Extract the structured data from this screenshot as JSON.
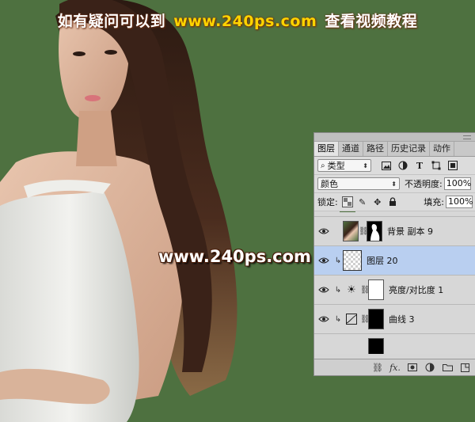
{
  "banner": {
    "part1": "如有疑问可以到",
    "url": "www.240ps.com",
    "part2": "查看视频教程"
  },
  "watermark": "www.240ps.com",
  "panel": {
    "tabs": [
      "图层",
      "通道",
      "路径",
      "历史记录",
      "动作"
    ],
    "active_tab": "图层",
    "filter": {
      "icon": "search-icon",
      "label": "类型"
    },
    "filter_icons": [
      "image-filter-icon",
      "adjustment-filter-icon",
      "type-filter-icon",
      "shape-filter-icon",
      "smart-object-filter-icon"
    ],
    "blend_mode": "颜色",
    "opacity_label": "不透明度:",
    "opacity_value": "100%",
    "lock_label": "锁定:",
    "lock_icons": [
      "lock-transparent-icon",
      "lock-paint-icon",
      "lock-position-icon",
      "lock-all-icon"
    ],
    "fill_label": "填充:",
    "fill_value": "100%",
    "layers": [
      {
        "name": "背景 副本 9",
        "selected": false,
        "clipped": false,
        "type": "pixel-with-mask"
      },
      {
        "name": "图层 20",
        "selected": true,
        "clipped": true,
        "type": "transparent"
      },
      {
        "name": "亮度/对比度 1",
        "selected": false,
        "clipped": true,
        "type": "brightness-contrast"
      },
      {
        "name": "曲线 3",
        "selected": false,
        "clipped": true,
        "type": "curves"
      }
    ],
    "bottom_icons": [
      "link-icon",
      "fx-icon",
      "mask-icon",
      "adjustment-icon",
      "folder-icon",
      "new-layer-icon"
    ],
    "fx_label": "fx."
  },
  "colors": {
    "background": "#4e7140",
    "banner_url": "#ffd400",
    "selected_layer": "#b9cff0"
  }
}
